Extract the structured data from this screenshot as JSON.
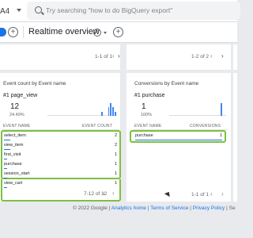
{
  "header": {
    "property_label": "A4",
    "search_placeholder": "Try searching \"how to do BigQuery export\""
  },
  "toolbar": {
    "title": "Realtime overview",
    "check_glyph": "✓",
    "add_glyph": "+"
  },
  "top_cards": {
    "left_pager": "1-1 of 1",
    "right_pager": "1-2 of 2",
    "chev_prev": "‹",
    "chev_next": "›"
  },
  "event_card": {
    "title": "Event count by Event name",
    "top_label": "#1  page_view",
    "top_value": "12",
    "top_pct": "24.49%",
    "col_name": "EVENT NAME",
    "col_value": "EVENT COUNT",
    "rows": [
      {
        "name": "select_item",
        "value": "2",
        "fraction": 0.4
      },
      {
        "name": "view_item",
        "value": "2",
        "fraction": 0.4
      },
      {
        "name": "first_visit",
        "value": "1",
        "fraction": 0.2
      },
      {
        "name": "purchase",
        "value": "1",
        "fraction": 0.2
      },
      {
        "name": "session_start",
        "value": "1",
        "fraction": 0.2
      },
      {
        "name": "view_cart",
        "value": "1",
        "fraction": 0.2
      }
    ],
    "pager": "7-12 of 12",
    "spark": [
      0,
      0,
      0,
      0,
      0,
      0,
      0,
      0,
      0,
      0,
      0,
      0,
      0,
      0,
      0,
      0,
      0,
      0,
      0,
      0,
      0,
      0,
      0,
      0,
      1,
      0,
      0,
      2,
      3,
      2,
      1
    ]
  },
  "conv_card": {
    "title": "Conversions by Event name",
    "top_label": "#1  purchase",
    "top_value": "1",
    "top_pct": "100%",
    "col_name": "EVENT NAME",
    "col_value": "CONVERSIONS",
    "rows": [
      {
        "name": "purchase",
        "value": "1",
        "fraction": 1.0
      }
    ],
    "pager": "1-1 of 1",
    "spark": [
      0,
      0,
      0,
      0,
      0,
      0,
      0,
      0,
      0,
      0,
      0,
      0,
      0,
      0,
      0,
      0,
      0,
      0,
      0,
      0,
      0,
      0,
      0,
      0,
      0,
      0,
      0,
      0,
      1,
      0,
      0
    ]
  },
  "footer": {
    "copyright": "© 2022 Google |",
    "link_home": "Analytics home",
    "sep1": "|",
    "link_terms": "Terms of Service",
    "sep2": "|",
    "link_privacy": "Privacy Policy",
    "sep3": "|",
    "link_feedback": "Se"
  },
  "colors": {
    "accent": "#1a73e8",
    "highlight": "#7cc142",
    "spark": "#4285f4"
  }
}
